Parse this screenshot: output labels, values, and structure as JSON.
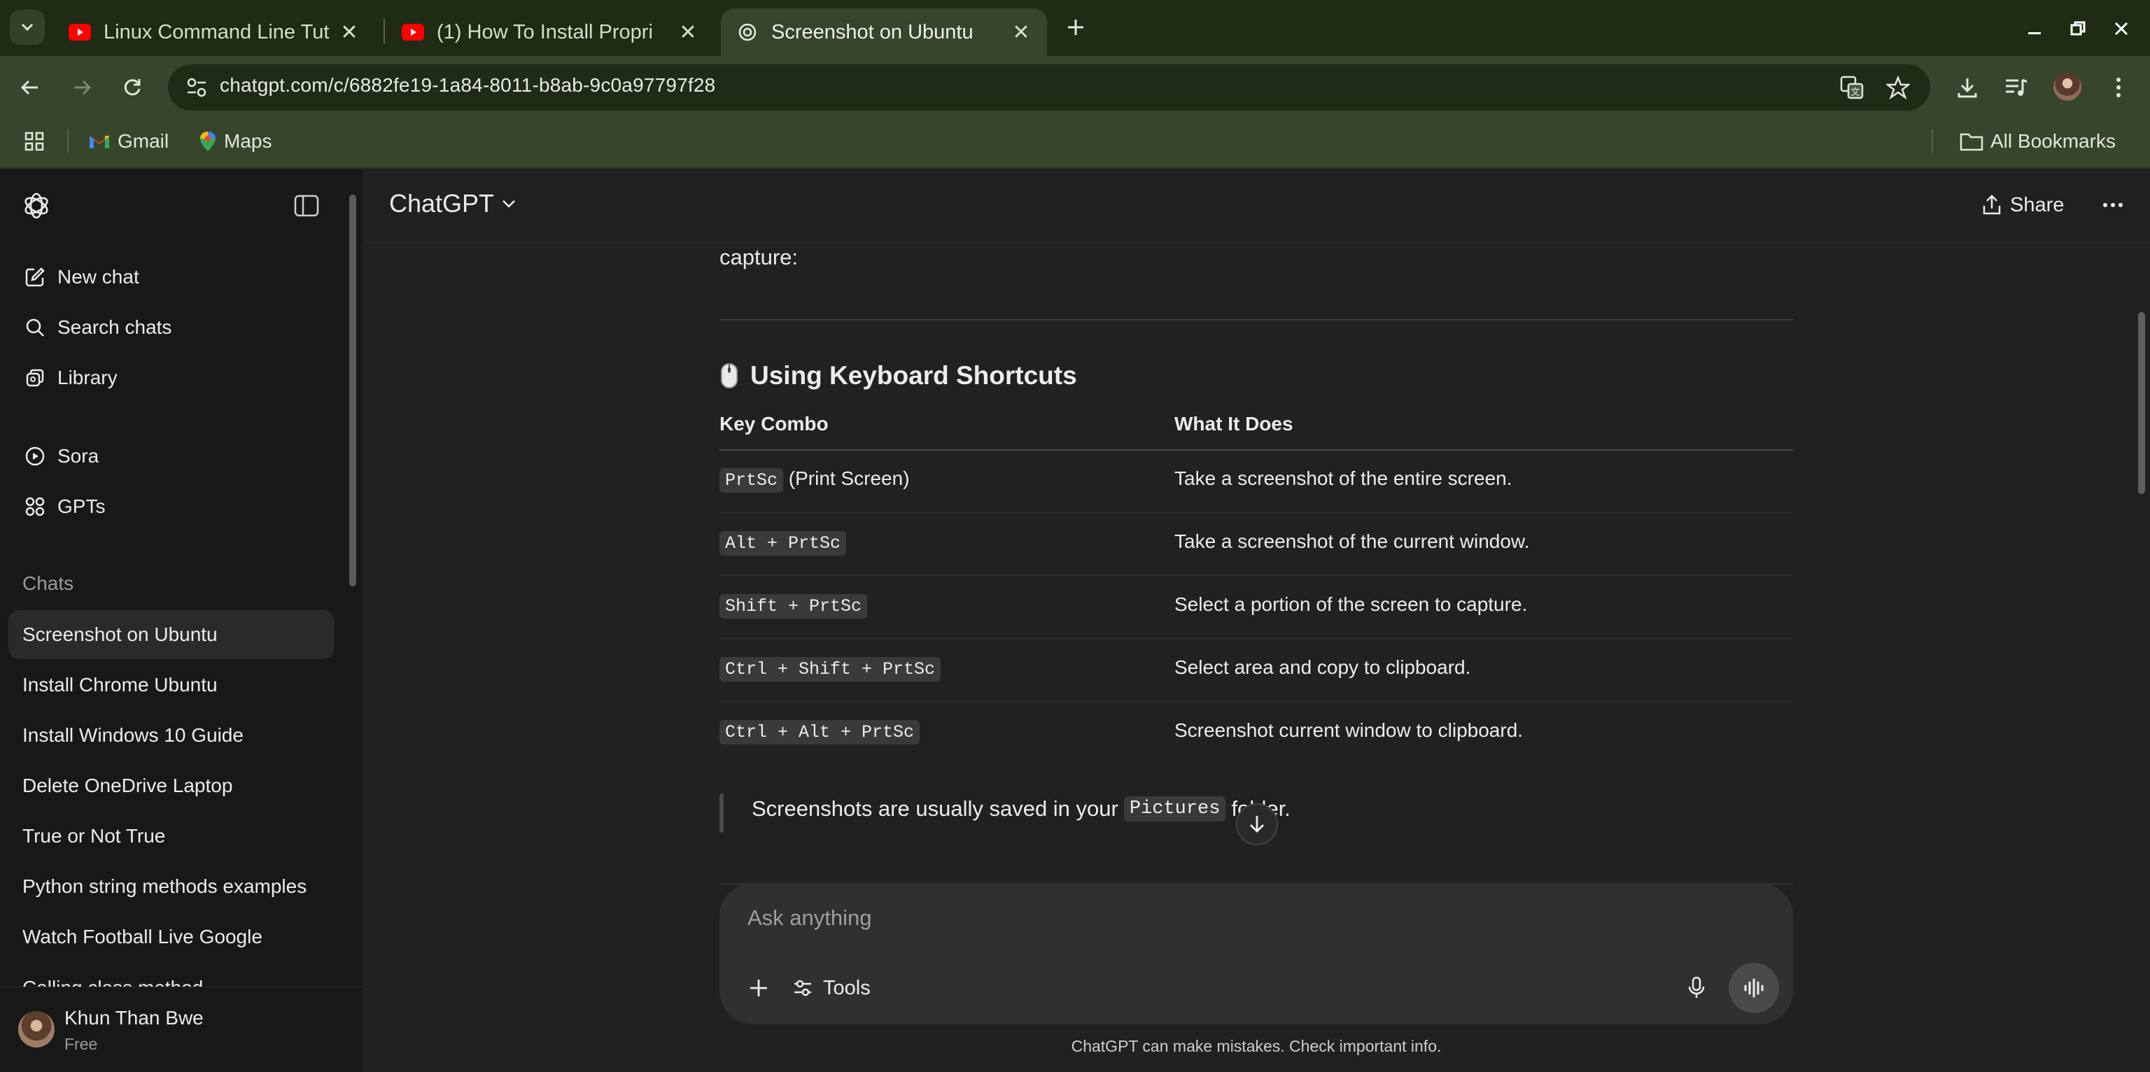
{
  "browser": {
    "tabs": [
      {
        "title": "Linux Command Line Tut",
        "favicon": "youtube-icon",
        "active": false
      },
      {
        "title": "(1) How To Install Propri",
        "favicon": "youtube-icon",
        "active": false
      },
      {
        "title": "Screenshot on Ubuntu",
        "favicon": "openai-icon",
        "active": true
      }
    ],
    "url": "chatgpt.com/c/6882fe19-1a84-8011-b8ab-9c0a97797f28",
    "bookmarks": [
      {
        "label": "Gmail",
        "icon": "gmail-icon"
      },
      {
        "label": "Maps",
        "icon": "maps-icon"
      }
    ],
    "all_bookmarks_label": "All Bookmarks"
  },
  "sidebar": {
    "actions": [
      {
        "label": "New chat",
        "icon": "compose-icon"
      },
      {
        "label": "Search chats",
        "icon": "search-icon"
      },
      {
        "label": "Library",
        "icon": "library-icon"
      }
    ],
    "apps": [
      {
        "label": "Sora",
        "icon": "play-circle-icon"
      },
      {
        "label": "GPTs",
        "icon": "grid-icon"
      }
    ],
    "chats_heading": "Chats",
    "chats": [
      "Screenshot on Ubuntu",
      "Install Chrome Ubuntu",
      "Install Windows 10 Guide",
      "Delete OneDrive Laptop",
      "True or Not True",
      "Python string methods examples",
      "Watch Football Live Google",
      "Calling class method"
    ],
    "user": {
      "name": "Khun Than Bwe",
      "plan": "Free"
    }
  },
  "header": {
    "model": "ChatGPT",
    "share_label": "Share"
  },
  "message": {
    "lead_tail": "capture:",
    "section_heading": "Using Keyboard Shortcuts",
    "section_emoji": "mouse-icon",
    "table": {
      "headers": [
        "Key Combo",
        "What It Does"
      ],
      "rows": [
        {
          "key": "PrtSc",
          "key_suffix": "(Print Screen)",
          "desc": "Take a screenshot of the entire screen."
        },
        {
          "key": "Alt + PrtSc",
          "key_suffix": "",
          "desc": "Take a screenshot of the current window."
        },
        {
          "key": "Shift + PrtSc",
          "key_suffix": "",
          "desc": "Select a portion of the screen to capture."
        },
        {
          "key": "Ctrl + Shift + PrtSc",
          "key_suffix": "",
          "desc": "Select area and copy to clipboard."
        },
        {
          "key": "Ctrl + Alt + PrtSc",
          "key_suffix": "",
          "desc": "Screenshot current window to clipboard."
        }
      ]
    },
    "quote": {
      "before": "Screenshots are usually saved in your",
      "code": "Pictures",
      "after": "folder."
    }
  },
  "composer": {
    "placeholder": "Ask anything",
    "tools_label": "Tools"
  },
  "disclaimer": "ChatGPT can make mistakes. Check important info.",
  "colors": {
    "browser_frame": "#1f2b14",
    "browser_toolbar": "#36452b",
    "sidebar_bg": "#181818",
    "main_bg": "#212121",
    "composer_bg": "#303030"
  }
}
